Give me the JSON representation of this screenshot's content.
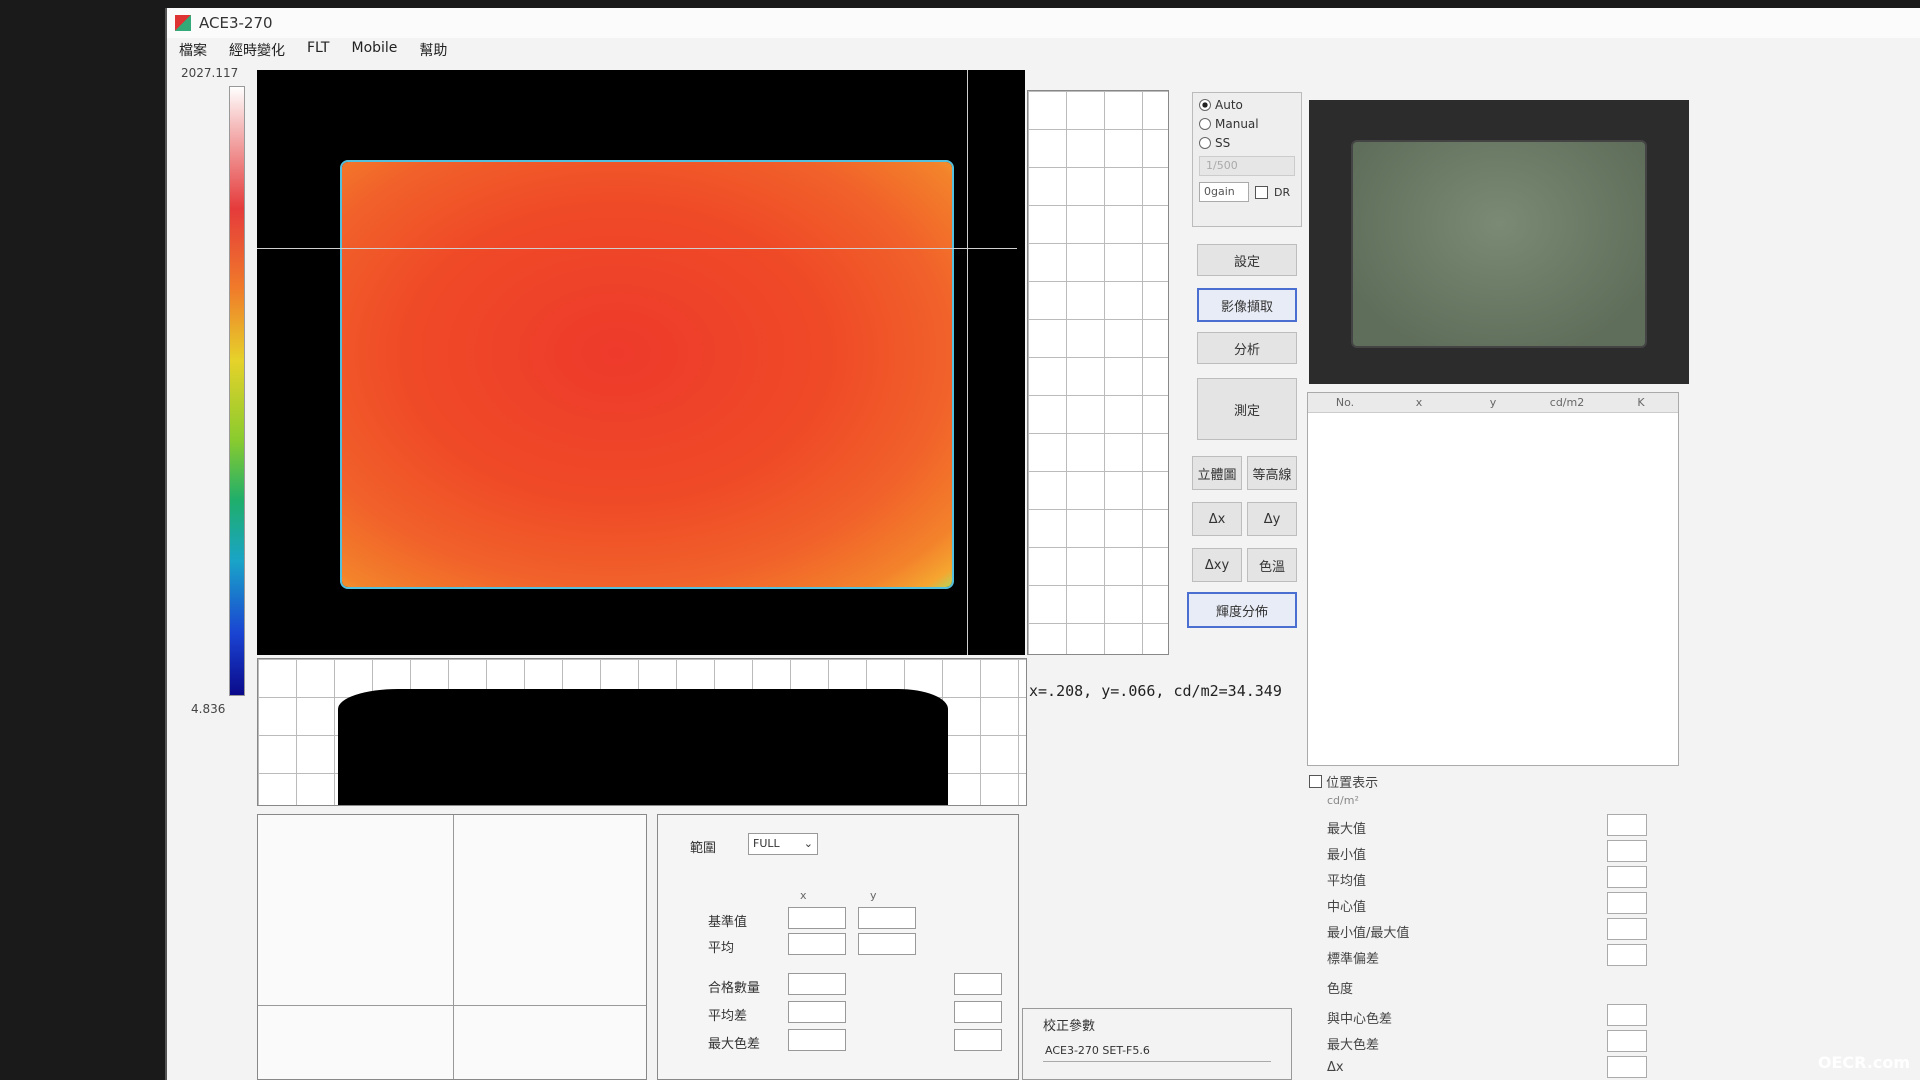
{
  "window": {
    "title": "ACE3-270"
  },
  "menu": [
    "檔案",
    "經時變化",
    "FLT",
    "Mobile",
    "幫助"
  ],
  "colorbar": {
    "max": "2027.117",
    "min": "4.836"
  },
  "coord_readout": "x=.208, y=.066, cd/m2=34.349",
  "mode": {
    "options": [
      "Auto",
      "Manual",
      "SS"
    ],
    "selected": "Auto",
    "shutter": "1/500",
    "gain": "0gain",
    "dr_label": "DR"
  },
  "buttons": {
    "settings": "設定",
    "capture": "影像擷取",
    "analyze": "分析",
    "measure": "測定",
    "view3d": "立體圖",
    "contour": "等高線",
    "dx": "Δx",
    "dy": "Δy",
    "dxy": "Δxy",
    "color_temp": "色溫",
    "luminance_dist": "輝度分佈"
  },
  "result_table": {
    "columns": [
      "No.",
      "x",
      "y",
      "cd/m2",
      "K"
    ]
  },
  "stats": {
    "position_display": "位置表示",
    "unit": "cd/m²",
    "rows": [
      "最大值",
      "最小值",
      "平均值",
      "中心值",
      "最小值/最大值",
      "標準偏差"
    ],
    "chroma_title": "色度",
    "chroma_rows": [
      "與中心色差",
      "最大色差",
      "Δx"
    ]
  },
  "range": {
    "label": "範圍",
    "value": "FULL",
    "col_x": "x",
    "col_y": "y",
    "rows": [
      "基準值",
      "平均"
    ],
    "rows2": [
      "合格數量",
      "平均差",
      "最大色差"
    ]
  },
  "calibration": {
    "title": "校正參數",
    "value": "ACE3-270 SET-F5.6"
  },
  "watermark": "OECR.com"
}
